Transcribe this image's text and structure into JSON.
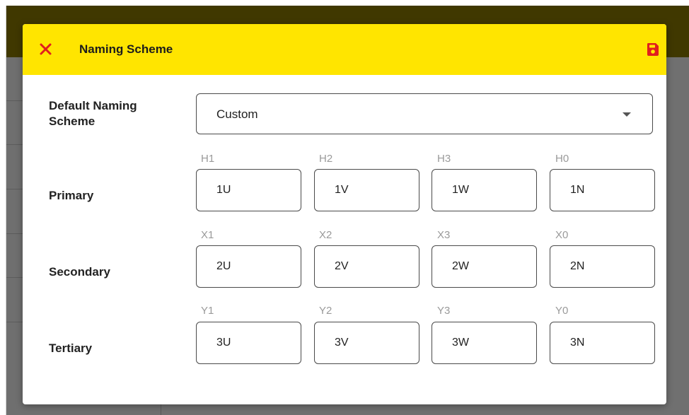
{
  "dialog": {
    "title": "Naming Scheme",
    "header_color": "#ffe500",
    "close_icon": "close-icon",
    "save_icon": "save-icon",
    "accent_color": "#e01e1e"
  },
  "default_scheme": {
    "label": "Default Naming Scheme",
    "label_line1": "Default Naming",
    "label_line2": "Scheme",
    "selected": "Custom"
  },
  "rows": [
    {
      "label": "Primary",
      "fields": [
        {
          "caption": "H1",
          "value": "1U"
        },
        {
          "caption": "H2",
          "value": "1V"
        },
        {
          "caption": "H3",
          "value": "1W"
        },
        {
          "caption": "H0",
          "value": "1N"
        }
      ]
    },
    {
      "label": "Secondary",
      "fields": [
        {
          "caption": "X1",
          "value": "2U"
        },
        {
          "caption": "X2",
          "value": "2V"
        },
        {
          "caption": "X3",
          "value": "2W"
        },
        {
          "caption": "X0",
          "value": "2N"
        }
      ]
    },
    {
      "label": "Tertiary",
      "fields": [
        {
          "caption": "Y1",
          "value": "3U"
        },
        {
          "caption": "Y2",
          "value": "3V"
        },
        {
          "caption": "Y3",
          "value": "3W"
        },
        {
          "caption": "Y0",
          "value": "3N"
        }
      ]
    }
  ]
}
